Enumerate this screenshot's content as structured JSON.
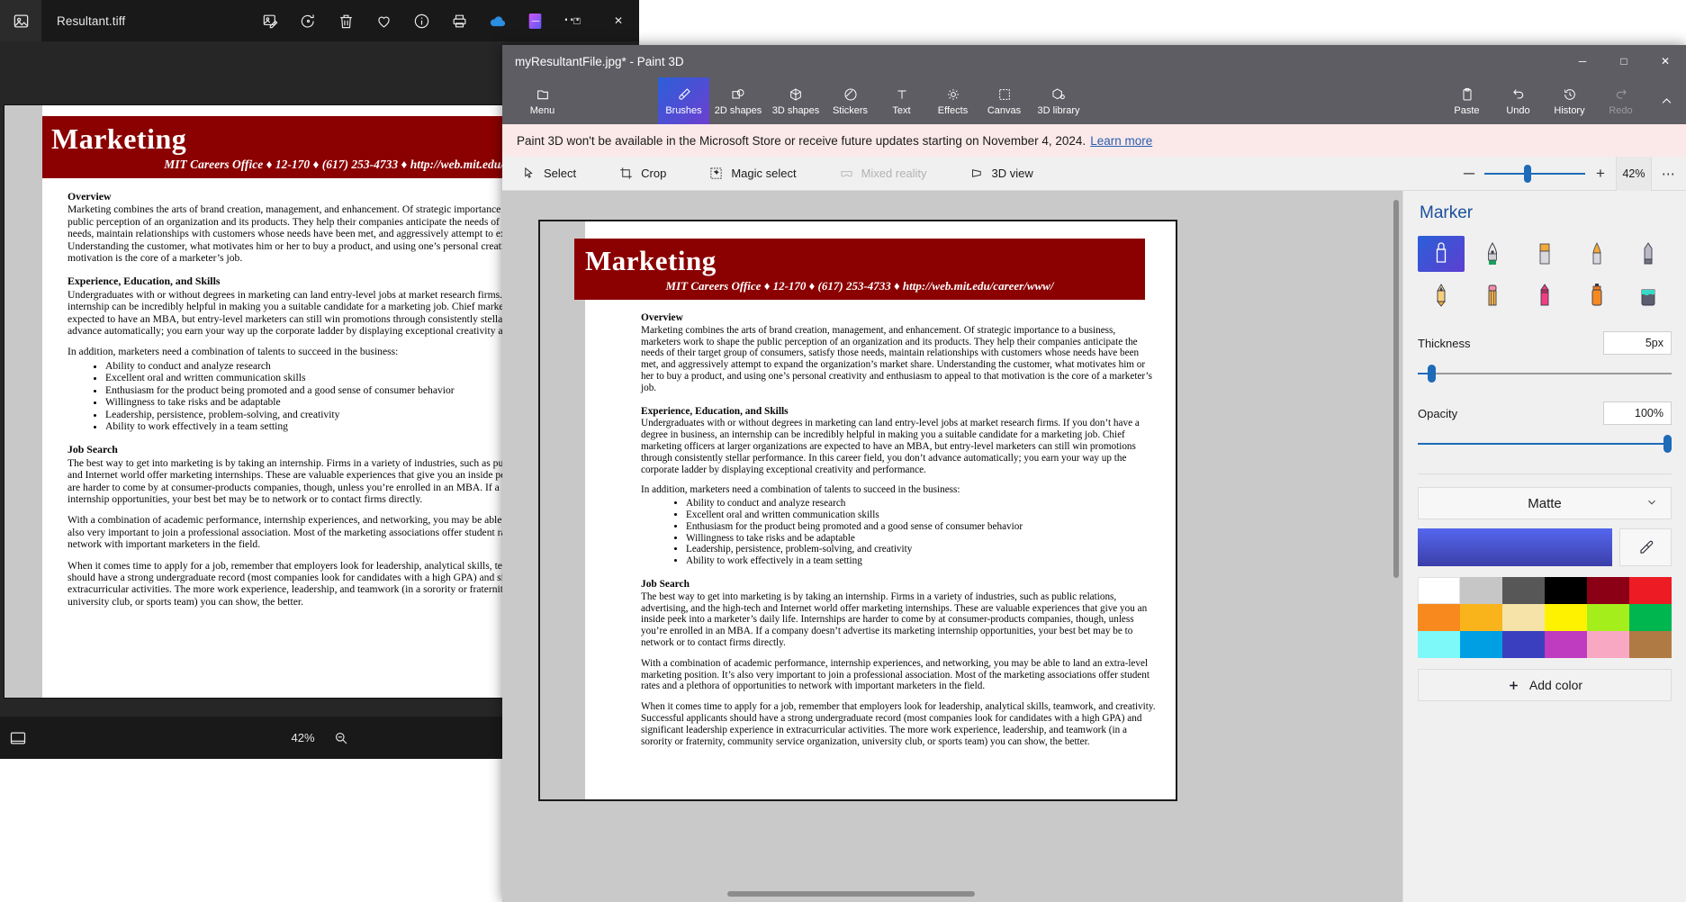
{
  "photos_window": {
    "title": "Resultant.tiff",
    "app_icon": "photo-icon",
    "toolbar": [
      {
        "name": "edit-image-icon",
        "label": "Edit image"
      },
      {
        "name": "rotate-icon",
        "label": "Rotate"
      },
      {
        "name": "delete-icon",
        "label": "Delete"
      },
      {
        "name": "favorite-icon",
        "label": "Add to favorites"
      },
      {
        "name": "info-icon",
        "label": "File info"
      },
      {
        "name": "print-icon",
        "label": "Print"
      },
      {
        "name": "onedrive-icon",
        "label": "OneDrive"
      },
      {
        "name": "clipchamp-icon",
        "label": "Clipchamp"
      },
      {
        "name": "more-options-icon",
        "label": "See more"
      }
    ],
    "window_controls": {
      "minimize": "─",
      "maximize": "□",
      "close": "✕"
    },
    "statusbar": {
      "fit_icon": "fit-to-window-icon",
      "zoom": "42%",
      "zoom_out_icon": "zoom-out-icon"
    }
  },
  "paint3d": {
    "title": "myResultantFile.jpg* - Paint 3D",
    "window_controls": {
      "minimize": "─",
      "maximize": "□",
      "close": "✕"
    },
    "ribbon": [
      {
        "label": "Menu",
        "icon": "folder-icon",
        "state": "normal"
      },
      {
        "label": "Brushes",
        "icon": "brush-icon",
        "state": "active"
      },
      {
        "label": "2D shapes",
        "icon": "2d-shapes-icon",
        "state": "normal"
      },
      {
        "label": "3D shapes",
        "icon": "3d-shapes-icon",
        "state": "normal"
      },
      {
        "label": "Stickers",
        "icon": "stickers-icon",
        "state": "normal"
      },
      {
        "label": "Text",
        "icon": "text-icon",
        "state": "normal"
      },
      {
        "label": "Effects",
        "icon": "effects-icon",
        "state": "normal"
      },
      {
        "label": "Canvas",
        "icon": "canvas-icon",
        "state": "normal"
      },
      {
        "label": "3D library",
        "icon": "3d-library-icon",
        "state": "normal"
      }
    ],
    "ribbon_right": [
      {
        "label": "Paste",
        "icon": "paste-icon",
        "state": "normal"
      },
      {
        "label": "Undo",
        "icon": "undo-icon",
        "state": "normal"
      },
      {
        "label": "History",
        "icon": "history-icon",
        "state": "normal"
      },
      {
        "label": "Redo",
        "icon": "redo-icon",
        "state": "disabled"
      }
    ],
    "collapse_icon": "chevron-up-icon",
    "banner": {
      "text": "Paint 3D won't be available in the Microsoft Store or receive future updates starting on November 4, 2024.",
      "link": "Learn more"
    },
    "toolbar": [
      {
        "label": "Select",
        "icon": "cursor-select-icon",
        "state": "normal"
      },
      {
        "label": "Crop",
        "icon": "crop-icon",
        "state": "normal"
      },
      {
        "label": "Magic select",
        "icon": "magic-select-icon",
        "state": "normal"
      },
      {
        "label": "Mixed reality",
        "icon": "mixed-reality-icon",
        "state": "disabled"
      },
      {
        "label": "3D view",
        "icon": "3d-view-icon",
        "state": "normal"
      }
    ],
    "zoom": {
      "minus": "─",
      "plus": "+",
      "percent": "42%",
      "more": "⋯",
      "slider_position_pct": 42
    },
    "panel": {
      "title": "Marker",
      "brushes": [
        {
          "name": "marker-brush",
          "selected": true
        },
        {
          "name": "calligraphy-pen-brush",
          "selected": false
        },
        {
          "name": "oil-brush",
          "selected": false
        },
        {
          "name": "watercolor-brush",
          "selected": false
        },
        {
          "name": "eraser-brush",
          "selected": false
        },
        {
          "name": "pencil-brush",
          "selected": false
        },
        {
          "name": "pixel-pen-brush",
          "selected": false
        },
        {
          "name": "crayon-brush",
          "selected": false
        },
        {
          "name": "spray-can-brush",
          "selected": false
        },
        {
          "name": "fill-brush",
          "selected": false
        }
      ],
      "thickness": {
        "label": "Thickness",
        "value": "5px",
        "slider_pct": 6
      },
      "opacity": {
        "label": "Opacity",
        "value": "100%",
        "slider_pct": 100
      },
      "material": {
        "label": "Matte",
        "chevron": "⌄"
      },
      "current_color": "#4b56e0",
      "eyedropper_icon": "eyedropper-icon",
      "swatches": [
        "#ffffff",
        "#c6c6c6",
        "#575757",
        "#000000",
        "#8b0014",
        "#ed1c24",
        "#f7891e",
        "#f9b41b",
        "#f5e3a8",
        "#fff200",
        "#a4ef1b",
        "#00b64f",
        "#7df9f9",
        "#009fe3",
        "#3a3fbf",
        "#bf3bbf",
        "#f9a8c4",
        "#b07a45"
      ],
      "add_color": {
        "label": "Add color",
        "icon": "plus-icon"
      }
    }
  },
  "document": {
    "header_title": "Marketing",
    "header_sub": "MIT Careers Office ♦ 12-170 ♦ (617) 253-4733 ♦ http://web.mit.edu/career/www/",
    "sections": [
      {
        "heading": "Overview",
        "paragraphs": [
          "Marketing combines the arts of brand creation, management, and enhancement.  Of strategic importance to a business, marketers work to shape the public perception of an organization and its products.  They help their companies anticipate the needs of their target group of consumers, satisfy those needs, maintain relationships with customers whose needs have been met, and aggressively attempt to expand the organization’s market share.  Understanding the customer, what motivates him or her to buy a product, and using one’s personal creativity and enthusiasm to appeal to that motivation is the core of a marketer’s job."
        ]
      },
      {
        "heading": "Experience, Education, and Skills",
        "paragraphs": [
          "Undergraduates with or without degrees in marketing can land entry-level jobs at market research firms.  If you don’t have a degree in business, an internship can be incredibly helpful in making you a suitable candidate for a marketing job.  Chief marketing officers at larger organizations are expected to have an MBA, but entry-level marketers can still win promotions through consistently stellar performance.  In this career field, you don’t advance automatically; you earn your way up the corporate ladder by displaying exceptional creativity and performance.",
          "In addition, marketers need a combination of talents to succeed in the business:"
        ],
        "bullets": [
          "Ability to conduct and analyze research",
          "Excellent oral and written communication skills",
          "Enthusiasm for the product being promoted and a good sense of consumer behavior",
          "Willingness to take risks and be adaptable",
          "Leadership, persistence, problem-solving, and creativity",
          "Ability to work effectively in a team setting"
        ]
      },
      {
        "heading": "Job Search",
        "paragraphs": [
          "The best way to get into marketing is by taking an internship.  Firms in a variety of industries, such as public relations, advertising, and the high-tech and Internet world offer marketing internships.  These are valuable experiences that give you an inside peek into a marketer’s daily life.  Internships are harder to come by at consumer-products companies, though, unless you’re enrolled in an MBA.  If a company doesn’t advertise its marketing internship opportunities, your best bet may be to network or to contact firms directly.",
          "With a combination of academic performance, internship experiences, and networking, you may be able to land an extra-level marketing position.  It’s also very important to join a professional association.  Most of the marketing associations offer student rates and a plethora of opportunities to network with important marketers in the field.",
          "When it comes time to apply for a job, remember that employers look for leadership, analytical skills, teamwork, and creativity.  Successful applicants should have a strong undergraduate record (most companies look for candidates with a high GPA) and significant leadership experience in extracurricular activities.  The more work experience, leadership, and teamwork (in a sorority or fraternity, community service organization, university club, or sports team) you can show, the better."
        ]
      }
    ]
  },
  "colors": {
    "accent_blue": "#1e6bb8",
    "ribbon_gray": "#5d5d63",
    "banner_pink": "#fbe9e9",
    "doc_red": "#8b0000"
  }
}
